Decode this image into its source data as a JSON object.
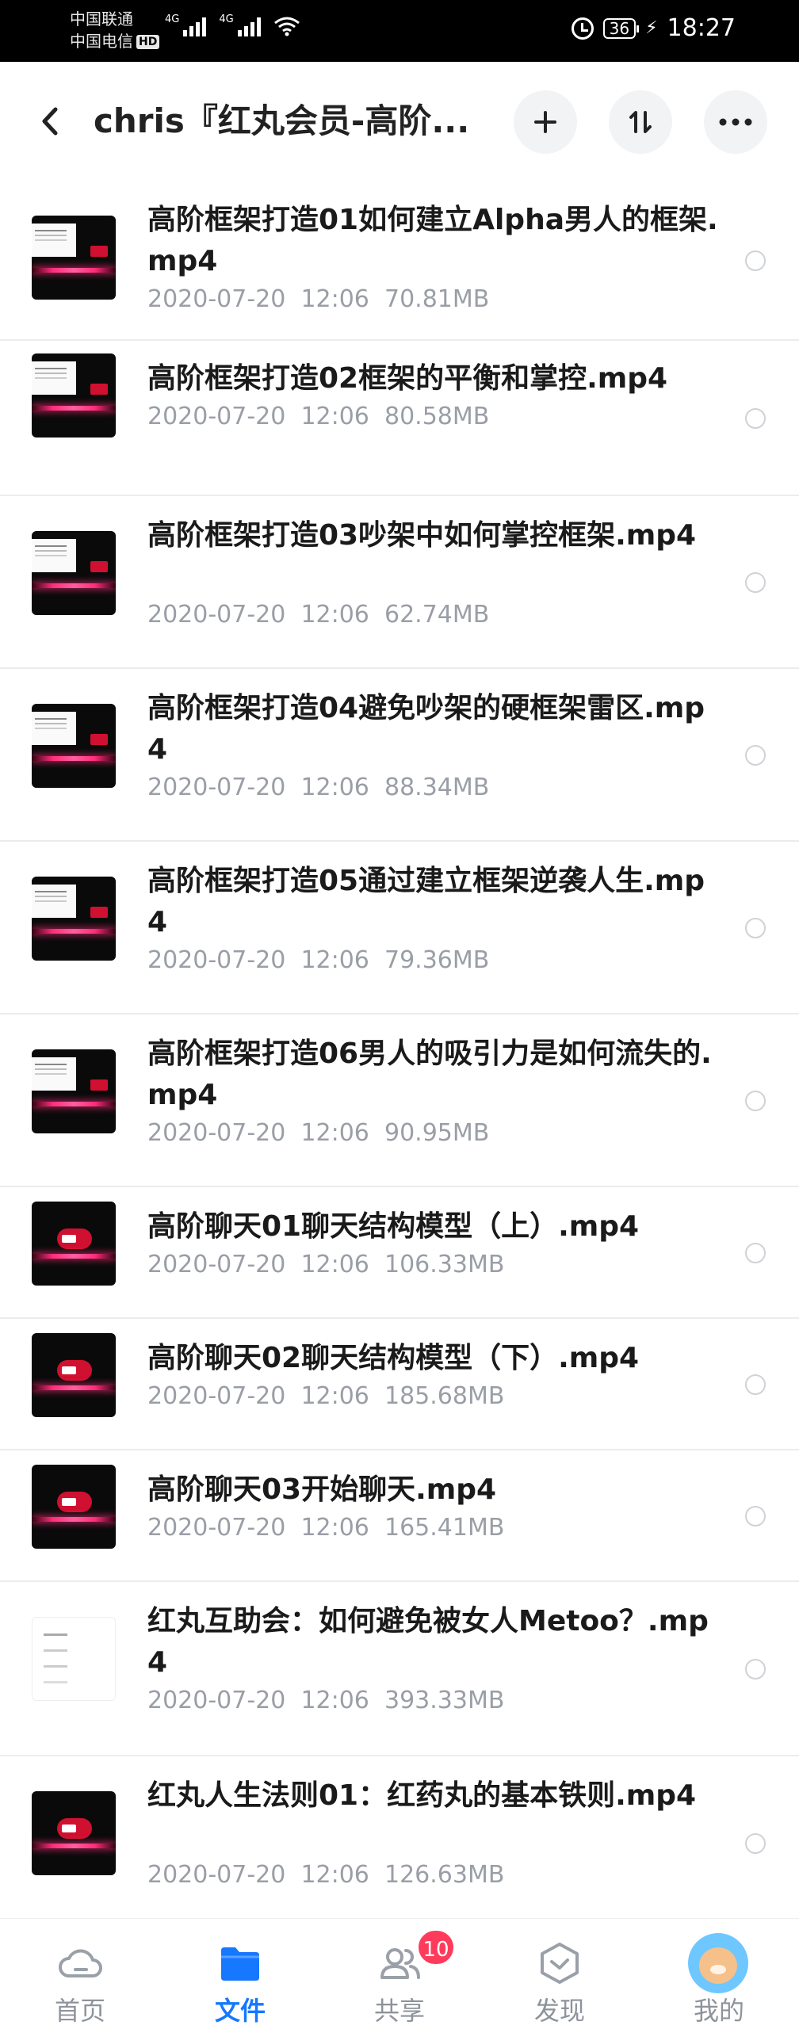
{
  "status_bar": {
    "carrier_1": "中国联通",
    "carrier_2": "中国电信",
    "hd_label": "HD",
    "network_1": "4G",
    "network_2": "4G",
    "battery": "36",
    "time": "18:27"
  },
  "header": {
    "title": "chris『红丸会员-高阶...",
    "icons": [
      "back-arrow-icon",
      "plus-icon",
      "sort-icon",
      "more-icon"
    ]
  },
  "files": [
    {
      "name": "高阶框架打造01如何建立Alpha男人的框架.mp4",
      "date": "2020-07-20",
      "time": "12:06",
      "size": "70.81MB",
      "thumb": "slide"
    },
    {
      "name": "高阶框架打造02框架的平衡和掌控.mp4",
      "date": "2020-07-20",
      "time": "12:06",
      "size": "80.58MB",
      "thumb": "slide"
    },
    {
      "name": "高阶框架打造03吵架中如何掌控框架.mp4",
      "date": "2020-07-20",
      "time": "12:06",
      "size": "62.74MB",
      "thumb": "slide"
    },
    {
      "name": "高阶框架打造04避免吵架的硬框架雷区.mp4",
      "date": "2020-07-20",
      "time": "12:06",
      "size": "88.34MB",
      "thumb": "slide"
    },
    {
      "name": "高阶框架打造05通过建立框架逆袭人生.mp4",
      "date": "2020-07-20",
      "time": "12:06",
      "size": "79.36MB",
      "thumb": "slide"
    },
    {
      "name": "高阶框架打造06男人的吸引力是如何流失的.mp4",
      "date": "2020-07-20",
      "time": "12:06",
      "size": "90.95MB",
      "thumb": "slide"
    },
    {
      "name": "高阶聊天01聊天结构模型（上）.mp4",
      "date": "2020-07-20",
      "time": "12:06",
      "size": "106.33MB",
      "thumb": "logo"
    },
    {
      "name": "高阶聊天02聊天结构模型（下）.mp4",
      "date": "2020-07-20",
      "time": "12:06",
      "size": "185.68MB",
      "thumb": "logo"
    },
    {
      "name": "高阶聊天03开始聊天.mp4",
      "date": "2020-07-20",
      "time": "12:06",
      "size": "165.41MB",
      "thumb": "logo"
    },
    {
      "name": "红丸互助会：如何避免被女人Metoo？.mp4",
      "date": "2020-07-20",
      "time": "12:06",
      "size": "393.33MB",
      "thumb": "chat"
    },
    {
      "name": "红丸人生法则01：红药丸的基本铁则.mp4",
      "date": "2020-07-20",
      "time": "12:06",
      "size": "126.63MB",
      "thumb": "logo"
    }
  ],
  "bottom_nav": [
    {
      "label": "首页",
      "icon": "cloud-icon",
      "active": false
    },
    {
      "label": "文件",
      "icon": "folder-icon",
      "active": true
    },
    {
      "label": "共享",
      "icon": "people-icon",
      "active": false,
      "badge": "10"
    },
    {
      "label": "发现",
      "icon": "cube-icon",
      "active": false
    },
    {
      "label": "我的",
      "icon": "avatar-icon",
      "active": false
    }
  ],
  "colors": {
    "accent": "#1677ff",
    "badge": "#ff3b5c",
    "meta_text": "#9a9ea6"
  }
}
